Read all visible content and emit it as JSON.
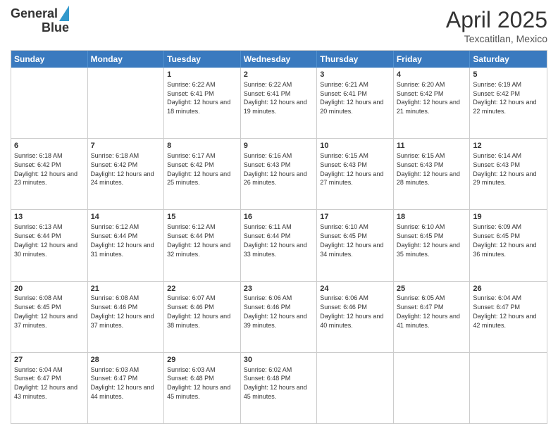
{
  "header": {
    "logo_line1": "General",
    "logo_line2": "Blue",
    "month": "April 2025",
    "location": "Texcatitlan, Mexico"
  },
  "calendar": {
    "days": [
      "Sunday",
      "Monday",
      "Tuesday",
      "Wednesday",
      "Thursday",
      "Friday",
      "Saturday"
    ],
    "weeks": [
      [
        {
          "day": "",
          "info": ""
        },
        {
          "day": "",
          "info": ""
        },
        {
          "day": "1",
          "info": "Sunrise: 6:22 AM\nSunset: 6:41 PM\nDaylight: 12 hours and 18 minutes."
        },
        {
          "day": "2",
          "info": "Sunrise: 6:22 AM\nSunset: 6:41 PM\nDaylight: 12 hours and 19 minutes."
        },
        {
          "day": "3",
          "info": "Sunrise: 6:21 AM\nSunset: 6:41 PM\nDaylight: 12 hours and 20 minutes."
        },
        {
          "day": "4",
          "info": "Sunrise: 6:20 AM\nSunset: 6:42 PM\nDaylight: 12 hours and 21 minutes."
        },
        {
          "day": "5",
          "info": "Sunrise: 6:19 AM\nSunset: 6:42 PM\nDaylight: 12 hours and 22 minutes."
        }
      ],
      [
        {
          "day": "6",
          "info": "Sunrise: 6:18 AM\nSunset: 6:42 PM\nDaylight: 12 hours and 23 minutes."
        },
        {
          "day": "7",
          "info": "Sunrise: 6:18 AM\nSunset: 6:42 PM\nDaylight: 12 hours and 24 minutes."
        },
        {
          "day": "8",
          "info": "Sunrise: 6:17 AM\nSunset: 6:42 PM\nDaylight: 12 hours and 25 minutes."
        },
        {
          "day": "9",
          "info": "Sunrise: 6:16 AM\nSunset: 6:43 PM\nDaylight: 12 hours and 26 minutes."
        },
        {
          "day": "10",
          "info": "Sunrise: 6:15 AM\nSunset: 6:43 PM\nDaylight: 12 hours and 27 minutes."
        },
        {
          "day": "11",
          "info": "Sunrise: 6:15 AM\nSunset: 6:43 PM\nDaylight: 12 hours and 28 minutes."
        },
        {
          "day": "12",
          "info": "Sunrise: 6:14 AM\nSunset: 6:43 PM\nDaylight: 12 hours and 29 minutes."
        }
      ],
      [
        {
          "day": "13",
          "info": "Sunrise: 6:13 AM\nSunset: 6:44 PM\nDaylight: 12 hours and 30 minutes."
        },
        {
          "day": "14",
          "info": "Sunrise: 6:12 AM\nSunset: 6:44 PM\nDaylight: 12 hours and 31 minutes."
        },
        {
          "day": "15",
          "info": "Sunrise: 6:12 AM\nSunset: 6:44 PM\nDaylight: 12 hours and 32 minutes."
        },
        {
          "day": "16",
          "info": "Sunrise: 6:11 AM\nSunset: 6:44 PM\nDaylight: 12 hours and 33 minutes."
        },
        {
          "day": "17",
          "info": "Sunrise: 6:10 AM\nSunset: 6:45 PM\nDaylight: 12 hours and 34 minutes."
        },
        {
          "day": "18",
          "info": "Sunrise: 6:10 AM\nSunset: 6:45 PM\nDaylight: 12 hours and 35 minutes."
        },
        {
          "day": "19",
          "info": "Sunrise: 6:09 AM\nSunset: 6:45 PM\nDaylight: 12 hours and 36 minutes."
        }
      ],
      [
        {
          "day": "20",
          "info": "Sunrise: 6:08 AM\nSunset: 6:45 PM\nDaylight: 12 hours and 37 minutes."
        },
        {
          "day": "21",
          "info": "Sunrise: 6:08 AM\nSunset: 6:46 PM\nDaylight: 12 hours and 37 minutes."
        },
        {
          "day": "22",
          "info": "Sunrise: 6:07 AM\nSunset: 6:46 PM\nDaylight: 12 hours and 38 minutes."
        },
        {
          "day": "23",
          "info": "Sunrise: 6:06 AM\nSunset: 6:46 PM\nDaylight: 12 hours and 39 minutes."
        },
        {
          "day": "24",
          "info": "Sunrise: 6:06 AM\nSunset: 6:46 PM\nDaylight: 12 hours and 40 minutes."
        },
        {
          "day": "25",
          "info": "Sunrise: 6:05 AM\nSunset: 6:47 PM\nDaylight: 12 hours and 41 minutes."
        },
        {
          "day": "26",
          "info": "Sunrise: 6:04 AM\nSunset: 6:47 PM\nDaylight: 12 hours and 42 minutes."
        }
      ],
      [
        {
          "day": "27",
          "info": "Sunrise: 6:04 AM\nSunset: 6:47 PM\nDaylight: 12 hours and 43 minutes."
        },
        {
          "day": "28",
          "info": "Sunrise: 6:03 AM\nSunset: 6:47 PM\nDaylight: 12 hours and 44 minutes."
        },
        {
          "day": "29",
          "info": "Sunrise: 6:03 AM\nSunset: 6:48 PM\nDaylight: 12 hours and 45 minutes."
        },
        {
          "day": "30",
          "info": "Sunrise: 6:02 AM\nSunset: 6:48 PM\nDaylight: 12 hours and 45 minutes."
        },
        {
          "day": "",
          "info": ""
        },
        {
          "day": "",
          "info": ""
        },
        {
          "day": "",
          "info": ""
        }
      ]
    ]
  }
}
